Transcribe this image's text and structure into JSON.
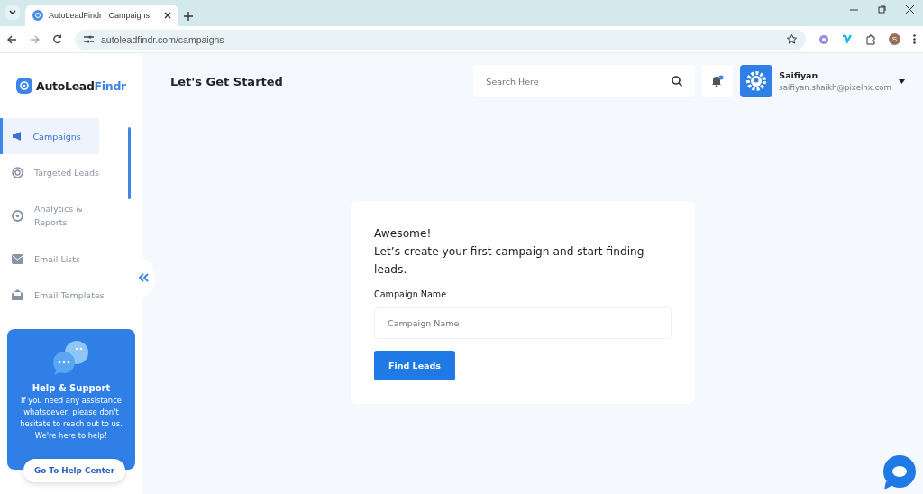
{
  "browser": {
    "tab_title": "AutoLeadFindr | Campaigns",
    "url": "autoleadfindr.com/campaigns",
    "profile_initial": "S"
  },
  "brand": {
    "name_a": "AutoLead",
    "name_b": "Findr"
  },
  "sidebar": {
    "items": [
      {
        "label": "Campaigns",
        "selected": true
      },
      {
        "label": "Targeted Leads",
        "selected": false
      },
      {
        "label": "Analytics & Reports",
        "selected": false
      },
      {
        "label": "Email Lists",
        "selected": false
      },
      {
        "label": "Email Templates",
        "selected": false
      }
    ]
  },
  "help": {
    "title": "Help & Support",
    "text": "If you need any assistance whatsoever, please don't hesitate to reach out to us. We're here to help!",
    "button": "Go To Help Center"
  },
  "header": {
    "title": "Let's Get Started",
    "search_placeholder": "Search Here",
    "notification_unread": true,
    "user_name": "Saifiyan",
    "user_email": "saifiyan.shaikh@pixelnx.com"
  },
  "card": {
    "heading": "Awesome!",
    "subheading": "Let’s create your first campaign and start finding leads.",
    "field_label": "Campaign Name",
    "field_placeholder": "Campaign Name",
    "button": "Find Leads"
  }
}
